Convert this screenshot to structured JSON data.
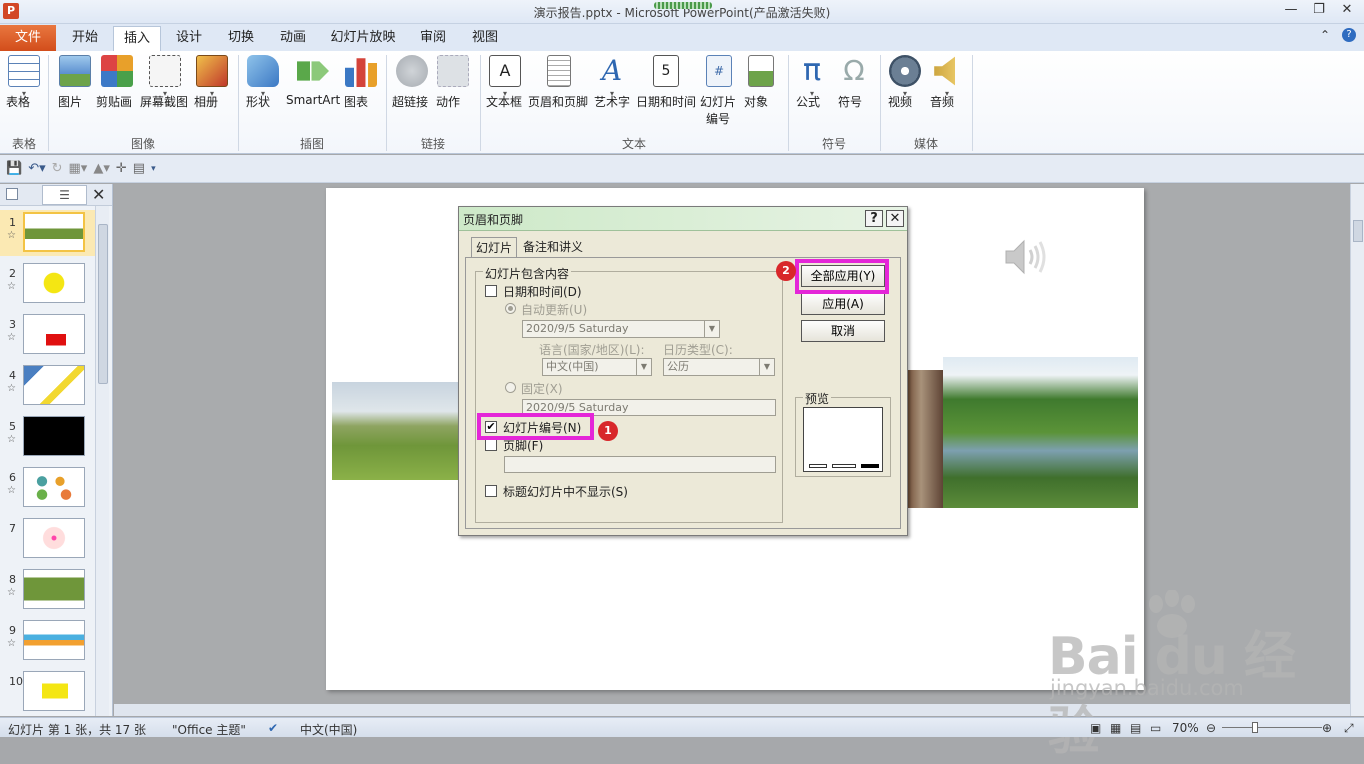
{
  "window": {
    "title": "演示报告.pptx - Microsoft PowerPoint(产品激活失败)"
  },
  "tabs": {
    "file": "文件",
    "items": [
      "开始",
      "插入",
      "设计",
      "切换",
      "动画",
      "幻灯片放映",
      "审阅",
      "视图"
    ],
    "active": "插入"
  },
  "ribbon": {
    "buttons": [
      {
        "label": "表格",
        "icon": "table-icon"
      },
      {
        "label": "图片",
        "icon": "picture-icon"
      },
      {
        "label": "剪贴画",
        "icon": "clipart-icon"
      },
      {
        "label": "屏幕截图",
        "icon": "screenshot-icon"
      },
      {
        "label": "相册",
        "icon": "photo-album-icon"
      },
      {
        "label": "形状",
        "icon": "shapes-icon"
      },
      {
        "label": "SmartArt",
        "icon": "smartart-icon"
      },
      {
        "label": "图表",
        "icon": "chart-icon"
      },
      {
        "label": "超链接",
        "icon": "hyperlink-icon"
      },
      {
        "label": "动作",
        "icon": "action-icon"
      },
      {
        "label": "文本框",
        "icon": "textbox-icon"
      },
      {
        "label": "页眉和页脚",
        "icon": "header-footer-icon"
      },
      {
        "label": "艺术字",
        "icon": "wordart-icon"
      },
      {
        "label": "日期和时间",
        "icon": "date-time-icon"
      },
      {
        "label": "幻灯片",
        "label2": "编号",
        "icon": "slide-number-icon"
      },
      {
        "label": "对象",
        "icon": "object-icon"
      },
      {
        "label": "公式",
        "icon": "equation-icon"
      },
      {
        "label": "符号",
        "icon": "symbol-icon"
      },
      {
        "label": "视频",
        "icon": "video-icon"
      },
      {
        "label": "音频",
        "icon": "audio-icon"
      }
    ],
    "groups": [
      "表格",
      "图像",
      "插图",
      "链接",
      "文本",
      "符号",
      "媒体"
    ]
  },
  "thumbnails": {
    "numbers": [
      "1",
      "2",
      "3",
      "4",
      "5",
      "6",
      "7",
      "8",
      "9",
      "10"
    ],
    "star": "☆"
  },
  "status": {
    "slide_info": "幻灯片 第 1 张，共 17 张",
    "theme": "\"Office 主题\"",
    "language": "中文(中国)",
    "zoom": "70%"
  },
  "dialog": {
    "title": "页眉和页脚",
    "help": "?",
    "close": "✕",
    "tabs": [
      "幻灯片",
      "备注和讲义"
    ],
    "group_label": "幻灯片包含内容",
    "date_time_label": "日期和时间(D)",
    "auto_update_label": "自动更新(U)",
    "auto_update_value": "2020/9/5 Saturday",
    "language_label": "语言(国家/地区)(L):",
    "calendar_label": "日历类型(C):",
    "language_value": "中文(中国)",
    "calendar_value": "公历",
    "fixed_label": "固定(X)",
    "fixed_value": "2020/9/5 Saturday",
    "slide_number_label": "幻灯片编号(N)",
    "footer_label": "页脚(F)",
    "no_title_label": "标题幻灯片中不显示(S)",
    "apply_all": "全部应用(Y)",
    "apply": "应用(A)",
    "cancel": "取消",
    "preview_label": "预览",
    "badges": [
      "1",
      "2"
    ]
  },
  "watermark": {
    "brand": "Bai du 经验",
    "url": "jingyan.baidu.com"
  }
}
